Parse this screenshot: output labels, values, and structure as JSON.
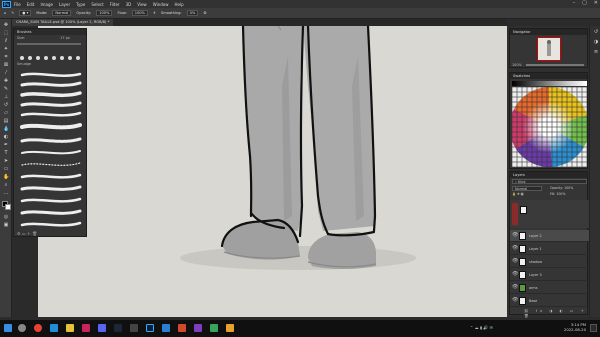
{
  "app": {
    "logo": "Ps"
  },
  "menu": [
    "File",
    "Edit",
    "Image",
    "Layer",
    "Type",
    "Select",
    "Filter",
    "3D",
    "View",
    "Window",
    "Help"
  ],
  "window_controls": [
    "–",
    "▢",
    "✕"
  ],
  "options": {
    "mode_label": "Mode:",
    "mode_value": "Normal",
    "opacity_label": "Opacity:",
    "opacity_value": "100%",
    "flow_label": "Flow:",
    "flow_value": "100%",
    "smoothing_label": "Smoothing:",
    "smoothing_value": "0%"
  },
  "document_tab": "CHARA_SUIN TAILLE.psd @ 100% (Layer 2, RGB/8) *",
  "brushes": {
    "title": "Brushes",
    "size_label": "Size:",
    "size_value": "17 px",
    "group": "Smudge"
  },
  "navigator": {
    "title": "Navigator",
    "zoom": "100%"
  },
  "swatches": {
    "title": "Swatches"
  },
  "layers": {
    "title": "Layers",
    "kind_label": "Kind",
    "blend": "Normal",
    "opacity_label": "Opacity:",
    "opacity_value": "100%",
    "fill_label": "Fill:",
    "fill_value": "100%",
    "items": [
      {
        "name": "Layer 2",
        "selected": true
      },
      {
        "name": "Layer 1",
        "selected": false
      },
      {
        "name": "shadow",
        "selected": false
      },
      {
        "name": "Layer 3",
        "selected": false
      },
      {
        "name": "arms",
        "selected": false
      },
      {
        "name": "Base",
        "selected": false
      }
    ]
  },
  "taskbar": {
    "time": "3:14 PM",
    "date": "2022-08-20"
  },
  "colors": {
    "accent": "#31a8ff",
    "canvas": "#dad8d3"
  }
}
